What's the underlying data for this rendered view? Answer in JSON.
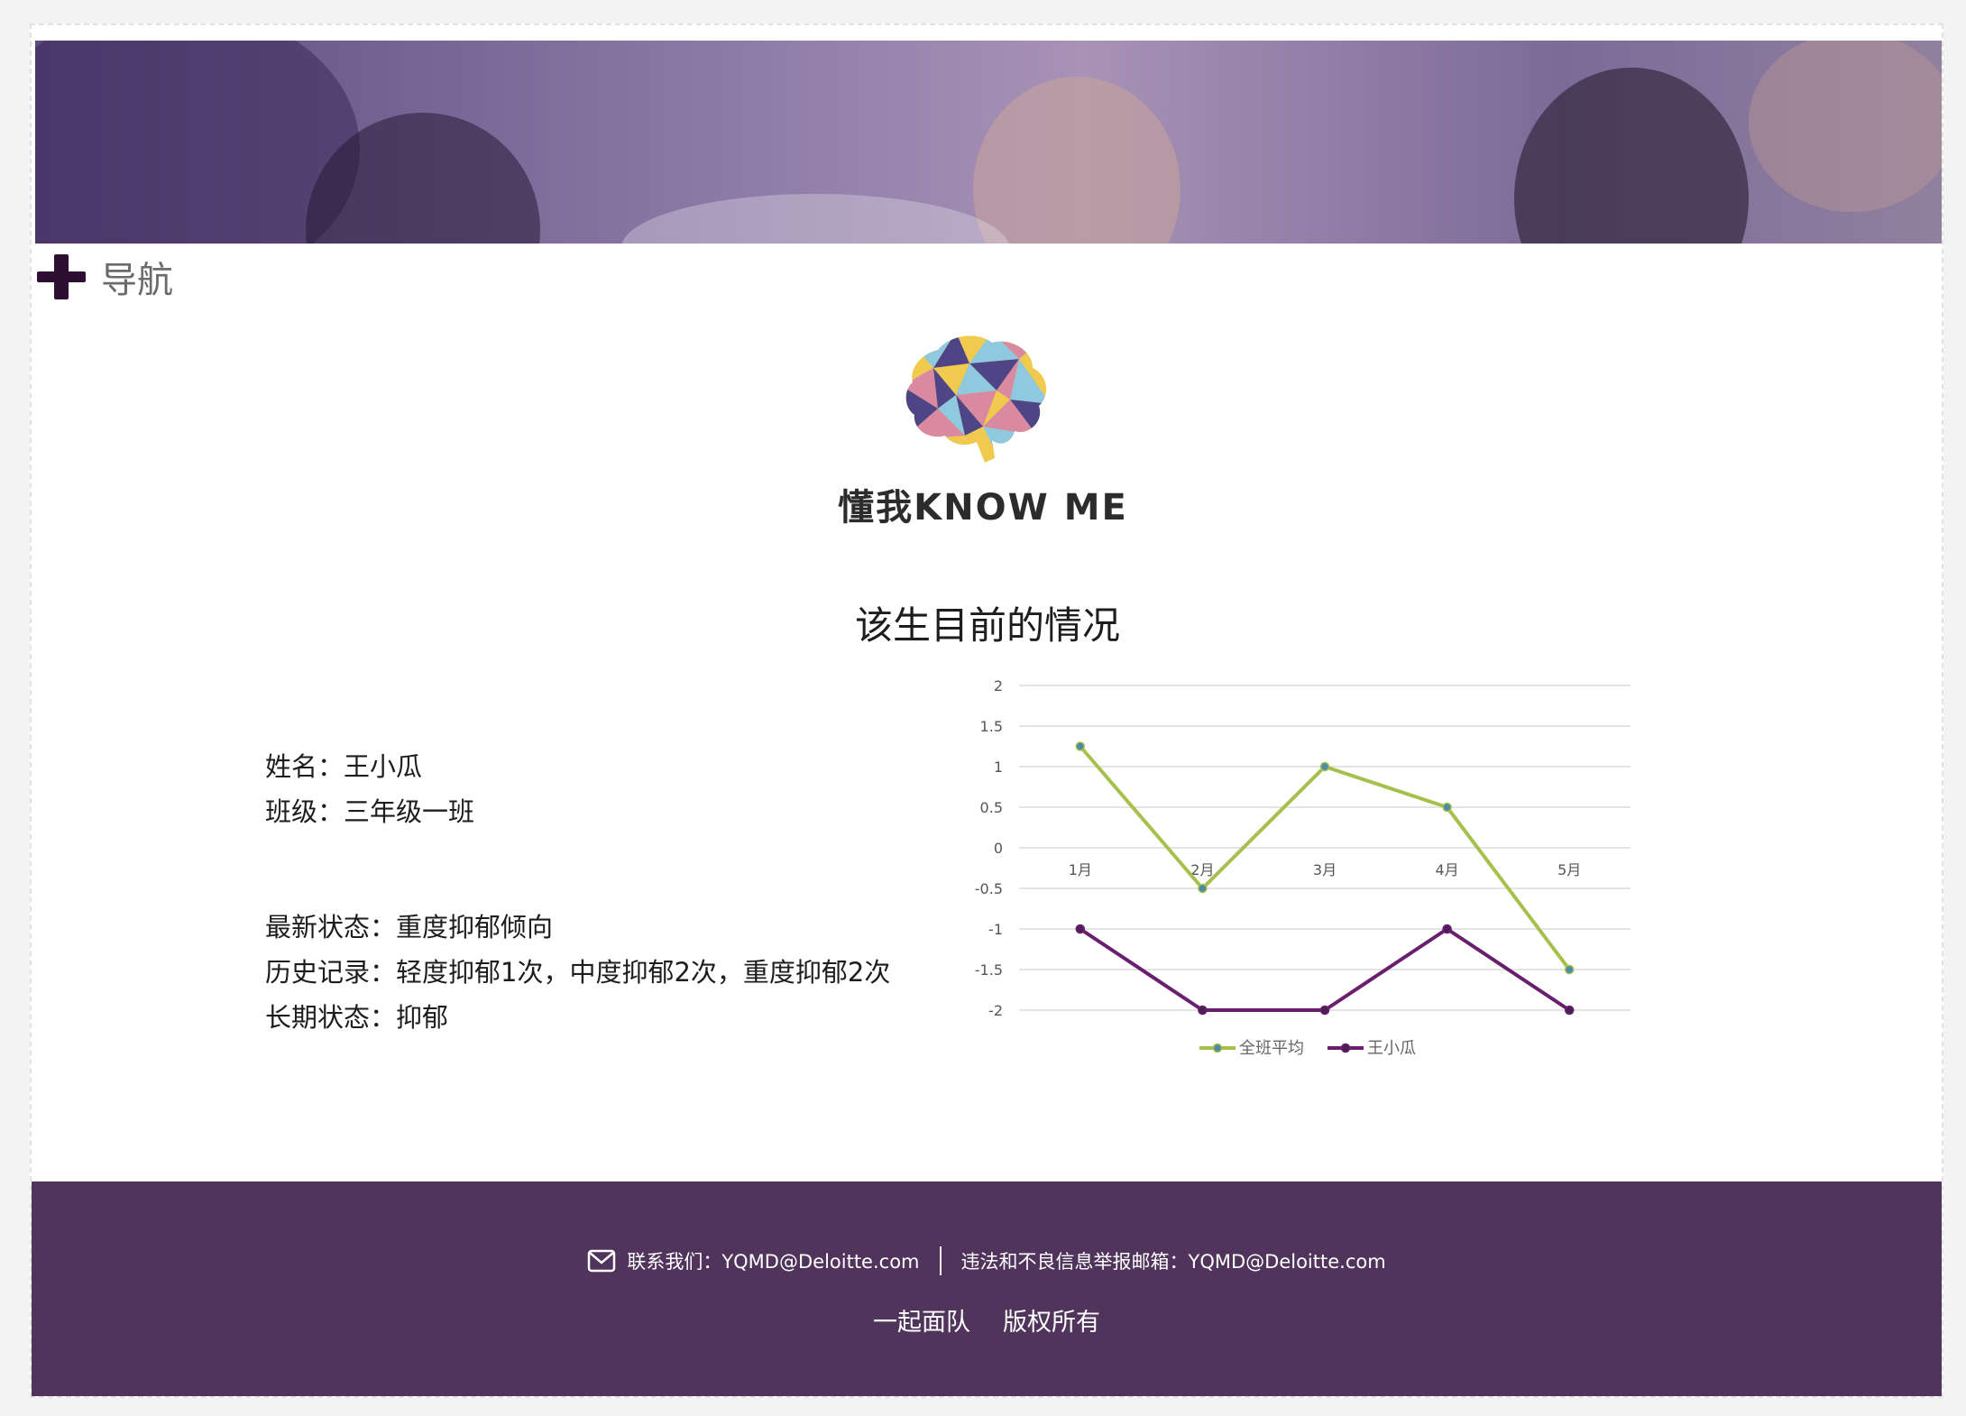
{
  "nav": {
    "label": "导航"
  },
  "brand": {
    "name": "懂我KNOW ME"
  },
  "section": {
    "title": "该生目前的情况"
  },
  "student": {
    "name_label": "姓名：",
    "name": "王小瓜",
    "class_label": "班级：",
    "class": "三年级一班",
    "latest_label": "最新状态：",
    "latest": "重度抑郁倾向",
    "history_label": "历史记录：",
    "history": "轻度抑郁1次，中度抑郁2次，重度抑郁2次",
    "longterm_label": "长期状态：",
    "longterm": "抑郁"
  },
  "chart_data": {
    "type": "line",
    "categories": [
      "1月",
      "2月",
      "3月",
      "4月",
      "5月"
    ],
    "series": [
      {
        "name": "全班平均",
        "values": [
          1.25,
          -0.5,
          1,
          0.5,
          -1.5
        ],
        "color": "#a6c04c"
      },
      {
        "name": "王小瓜",
        "values": [
          -1,
          -2,
          -2,
          -1,
          -2
        ],
        "color": "#6a1f6e"
      }
    ],
    "ylim": [
      -2,
      2
    ],
    "yticks": [
      "2",
      "1.5",
      "1",
      "0.5",
      "0",
      "-0.5",
      "-1",
      "-1.5",
      "-2"
    ],
    "grid": true,
    "legend_position": "bottom",
    "title": "",
    "xlabel": "",
    "ylabel": ""
  },
  "footer": {
    "contact_label": "联系我们：YQMD@Deloitte.com",
    "report_label": "违法和不良信息举报邮箱：YQMD@Deloitte.com",
    "team": "一起面队",
    "copyright": "版权所有"
  },
  "colors": {
    "footer_bg": "#51345c",
    "accent_purple": "#2e0f33",
    "series_green": "#a6c04c",
    "series_purple": "#6a1f6e"
  },
  "icons": {
    "nav": "plus-icon",
    "logo": "brain-logo-icon",
    "mail": "mail-icon"
  }
}
